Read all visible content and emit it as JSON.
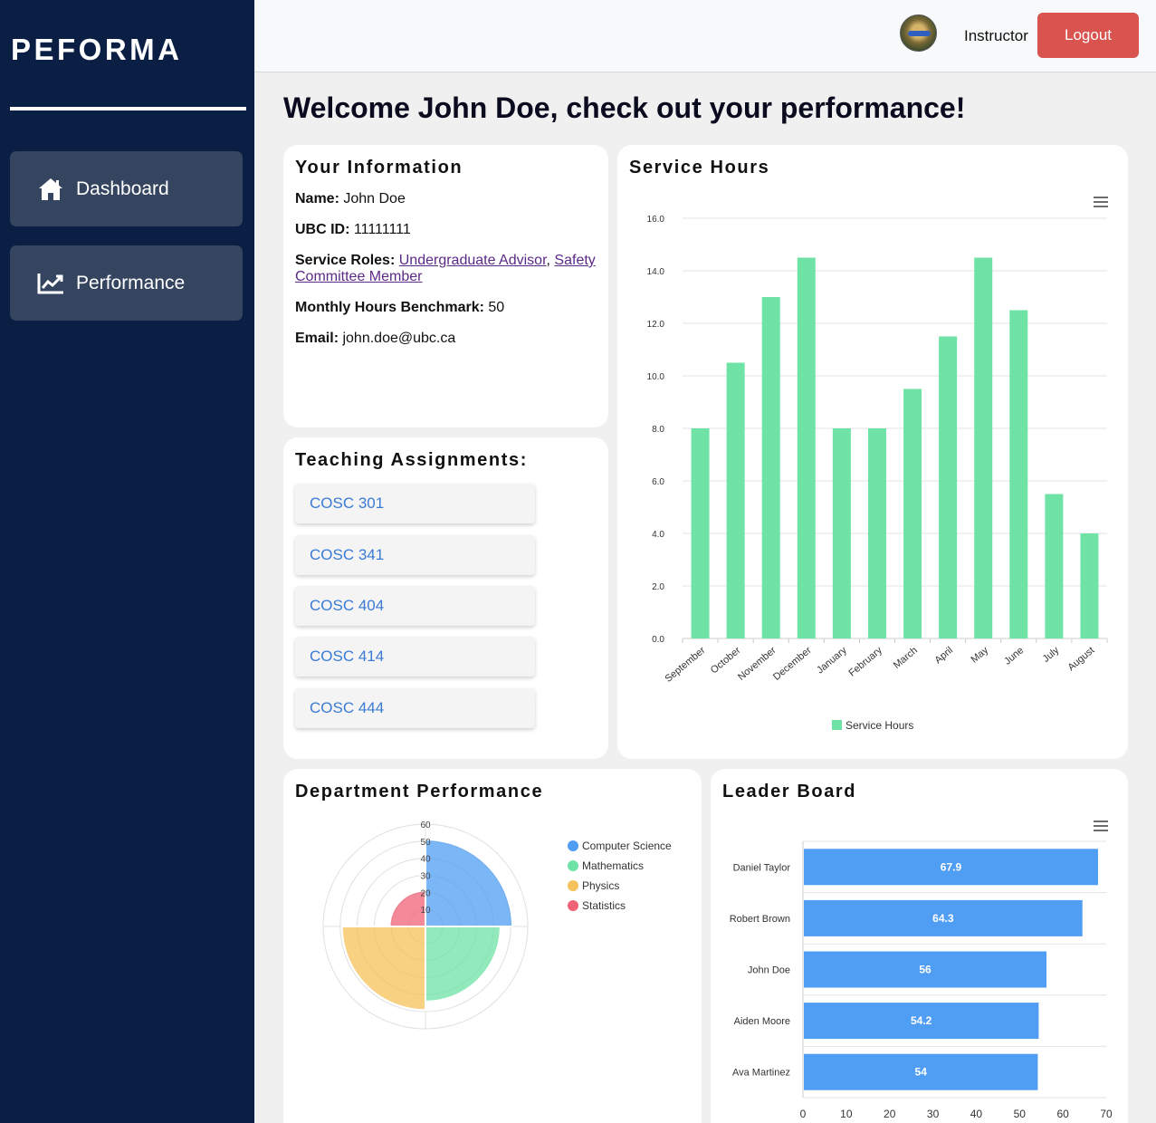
{
  "brand": "PEFORMA",
  "nav": [
    {
      "label": "Dashboard",
      "icon": "home-icon"
    },
    {
      "label": "Performance",
      "icon": "chart-line-icon"
    }
  ],
  "topbar": {
    "role": "Instructor",
    "logout_label": "Logout"
  },
  "welcome": "Welcome John Doe, check out your performance!",
  "info": {
    "title": "Your Information",
    "name_label": "Name:",
    "name": "John Doe",
    "id_label": "UBC ID:",
    "id": "11111111",
    "roles_label": "Service Roles:",
    "roles": [
      "Undergraduate Advisor",
      "Safety Committee Member"
    ],
    "roles_sep": ",",
    "benchmark_label": "Monthly Hours Benchmark:",
    "benchmark": "50",
    "email_label": "Email:",
    "email": "john.doe@ubc.ca"
  },
  "teaching": {
    "title": "Teaching Assignments:",
    "courses": [
      "COSC 301",
      "COSC 341",
      "COSC 404",
      "COSC 414",
      "COSC 444"
    ]
  },
  "service_title": "Service Hours",
  "dept_title": "Department Performance",
  "leader_title": "Leader Board",
  "colors": {
    "accent_green": "#6ee3a5",
    "bar_blue": "#4f9ef3",
    "logout": "#d9534f",
    "sidebar": "#0b1f45"
  },
  "chart_data": [
    {
      "type": "bar",
      "categories": [
        "September",
        "October",
        "November",
        "December",
        "January",
        "February",
        "March",
        "April",
        "May",
        "June",
        "July",
        "August"
      ],
      "series": [
        {
          "name": "Service Hours",
          "values": [
            8,
            10.5,
            13,
            14.5,
            8,
            8,
            9.5,
            11.5,
            14.5,
            12.5,
            5.5,
            4
          ]
        }
      ],
      "ylim": [
        0,
        16
      ],
      "yticks": [
        "0.0",
        "2.0",
        "4.0",
        "6.0",
        "8.0",
        "10.0",
        "12.0",
        "14.0",
        "16.0"
      ],
      "legend": "bottom",
      "grid": true,
      "color": "#6ee3a5"
    },
    {
      "type": "polar-area",
      "categories": [
        "Computer Science",
        "Mathematics",
        "Physics",
        "Statistics"
      ],
      "values": [
        51,
        44,
        49,
        21
      ],
      "colors": [
        "#4f9ef3",
        "#6ee3a5",
        "#f5c15a",
        "#ef6277"
      ],
      "rlim": [
        0,
        60
      ],
      "rticks": [
        "10",
        "20",
        "30",
        "40",
        "50",
        "60"
      ],
      "legend": "right"
    },
    {
      "type": "bar",
      "orientation": "horizontal",
      "categories": [
        "Daniel Taylor",
        "Robert Brown",
        "John Doe",
        "Aiden Moore",
        "Ava Martinez"
      ],
      "values": [
        67.9,
        64.3,
        56,
        54.2,
        54
      ],
      "data_labels": [
        "67.9",
        "64.3",
        "56",
        "54.2",
        "54"
      ],
      "xlim": [
        0,
        70
      ],
      "xticks": [
        "0",
        "10",
        "20",
        "30",
        "40",
        "50",
        "60",
        "70"
      ],
      "color": "#4f9ef3"
    }
  ]
}
